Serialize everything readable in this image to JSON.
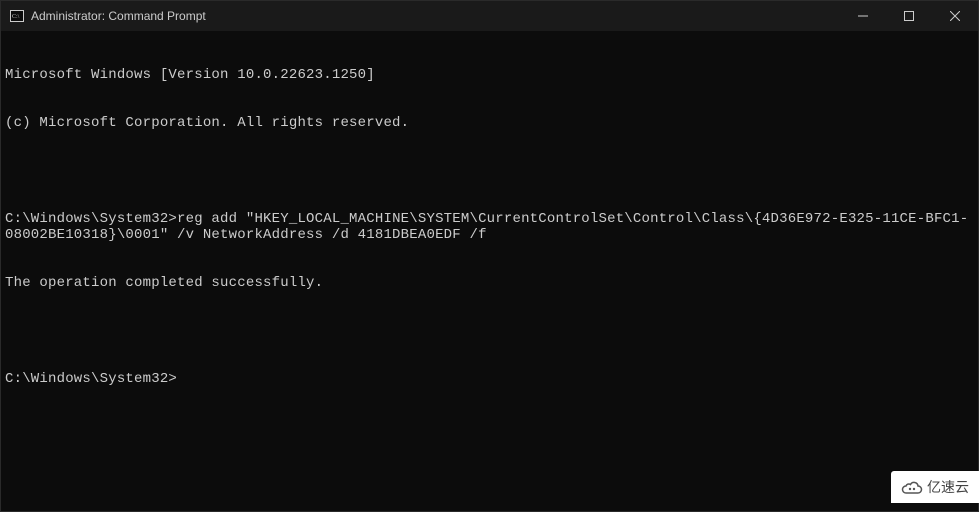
{
  "titlebar": {
    "title": "Administrator: Command Prompt",
    "minimize_label": "Minimize",
    "maximize_label": "Maximize",
    "close_label": "Close"
  },
  "terminal": {
    "banner_line1": "Microsoft Windows [Version 10.0.22623.1250]",
    "banner_line2": "(c) Microsoft Corporation. All rights reserved.",
    "prompt1": "C:\\Windows\\System32>",
    "command1": "reg add \"HKEY_LOCAL_MACHINE\\SYSTEM\\CurrentControlSet\\Control\\Class\\{4D36E972-E325-11CE-BFC1-08002BE10318}\\0001\" /v NetworkAddress /d 4181DBEA0EDF /f",
    "result1": "The operation completed successfully.",
    "prompt2": "C:\\Windows\\System32>"
  },
  "watermark": {
    "text": "亿速云"
  }
}
